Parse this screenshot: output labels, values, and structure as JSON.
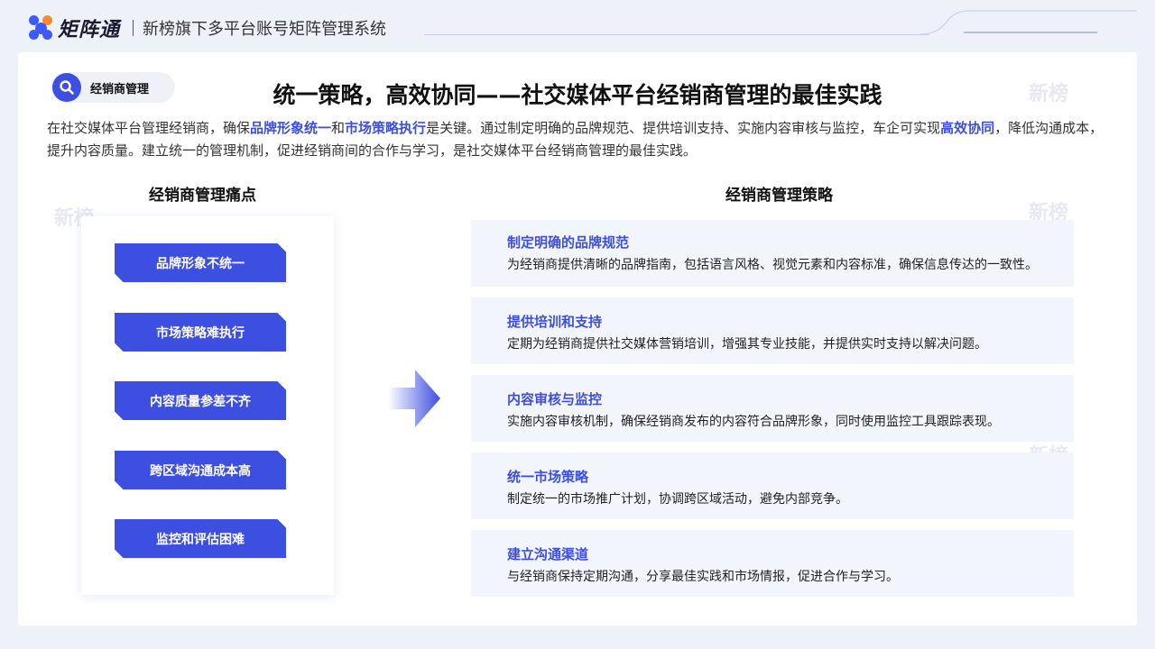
{
  "header": {
    "brand": "矩阵通",
    "subtitle": "新榜旗下多平台账号矩阵管理系统"
  },
  "badge": {
    "label": "经销商管理"
  },
  "title": "统一策略，高效协同——社交媒体平台经销商管理的最佳实践",
  "intro": {
    "p1": "在社交媒体平台管理经销商，确保",
    "hl1": "品牌形象统一",
    "p2": "和",
    "hl2": "市场策略执行",
    "p3": "是关键。通过制定明确的品牌规范、提供培训支持、实施内容审核与监控，车企可实现",
    "hl3": "高效协同",
    "p4": "，降低沟通成本，提升内容质量。建立统一的管理机制，促进经销商间的合作与学习，是社交媒体平台经销商管理的最佳实践。"
  },
  "pain_section": {
    "heading": "经销商管理痛点",
    "items": [
      "品牌形象不统一",
      "市场策略难执行",
      "内容质量参差不齐",
      "跨区域沟通成本高",
      "监控和评估困难"
    ]
  },
  "strategy_section": {
    "heading": "经销商管理策略",
    "items": [
      {
        "title": "制定明确的品牌规范",
        "desc": "为经销商提供清晰的品牌指南，包括语言风格、视觉元素和内容标准，确保信息传达的一致性。"
      },
      {
        "title": "提供培训和支持",
        "desc": "定期为经销商提供社交媒体营销培训，增强其专业技能，并提供实时支持以解决问题。"
      },
      {
        "title": "内容审核与监控",
        "desc": "实施内容审核机制，确保经销商发布的内容符合品牌形象，同时使用监控工具跟踪表现。"
      },
      {
        "title": "统一市场策略",
        "desc": "制定统一的市场推广计划，协调跨区域活动，避免内部竞争。"
      },
      {
        "title": "建立沟通渠道",
        "desc": "与经销商保持定期沟通，分享最佳实践和市场情报，促进合作与学习。"
      }
    ]
  },
  "colors": {
    "accent": "#3d4fe0",
    "logo_blue": "#3d5afe",
    "logo_orange": "#ff8a2a"
  },
  "icons": [
    "logo-mark-icon",
    "search-icon",
    "arrow-right-icon"
  ]
}
